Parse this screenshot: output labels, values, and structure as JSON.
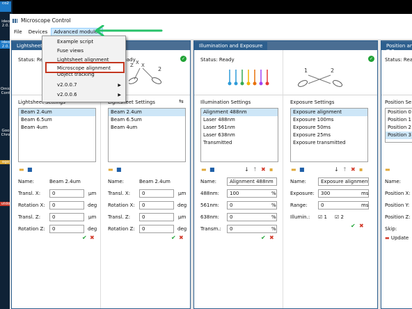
{
  "desktop": {
    "icons": [
      "co2",
      "ideo 2.0.",
      "ideo 2.0.",
      "Omic Cont",
      "Goo Chro",
      "ogo",
      "utdo"
    ]
  },
  "window": {
    "title": "Microscope Control"
  },
  "menubar": {
    "items": [
      "File",
      "Devices",
      "Advanced modules"
    ]
  },
  "dropdown": {
    "items": [
      {
        "label": "Example script"
      },
      {
        "label": "Fuse views"
      },
      {
        "label": "Lightsheet alignment"
      },
      {
        "label": "Microscope alignment",
        "highlighted": true
      },
      {
        "label": "Object tracking"
      },
      {
        "label": "v2.0.0.7",
        "submenu": true
      },
      {
        "label": "v2.0.0.6",
        "submenu": true
      }
    ]
  },
  "groups": {
    "lightsheet": {
      "tab": "Lightsheet 1",
      "status": "Status: Ready",
      "status_right": "Ready",
      "settings": [
        {
          "title": "Lightsheet Settings",
          "items": [
            "Beam 2.4um",
            "Beam 6.5um",
            "Beam 4um"
          ],
          "selected": 0,
          "fields": [
            {
              "label": "Name:",
              "value": "Beam 2.4um",
              "unit": ""
            },
            {
              "label": "Transl. X:",
              "value": "0",
              "unit": "μm"
            },
            {
              "label": "Rotation X:",
              "value": "0",
              "unit": "deg"
            },
            {
              "label": "Transl. Z:",
              "value": "0",
              "unit": "μm"
            },
            {
              "label": "Rotation Z:",
              "value": "0",
              "unit": "deg"
            }
          ]
        },
        {
          "title": "Lightsheet Settings",
          "items": [
            "Beam 2.4um",
            "Beam 6.5um",
            "Beam 4um"
          ],
          "selected": 0,
          "fields": [
            {
              "label": "Name:",
              "value": "Beam 2.4um",
              "unit": ""
            },
            {
              "label": "Transl. X:",
              "value": "0",
              "unit": "μm"
            },
            {
              "label": "Rotation X:",
              "value": "0",
              "unit": "deg"
            },
            {
              "label": "Transl. Z:",
              "value": "0",
              "unit": "μm"
            },
            {
              "label": "Rotation Z:",
              "value": "0",
              "unit": "deg"
            }
          ]
        }
      ]
    },
    "illumination": {
      "tab": "Illumination and Exposure",
      "status": "Status: Ready",
      "ill_title": "Illumination Settings",
      "ill_items": [
        "Alignment 488nm",
        "Laser 488nm",
        "Laser 561nm",
        "Laser 638nm",
        "Transmitted"
      ],
      "ill_fields": [
        {
          "label": "Name:",
          "value": "Alignment 488nm",
          "unit": ""
        },
        {
          "label": "488nm:",
          "value": "100",
          "unit": "%"
        },
        {
          "label": "561nm:",
          "value": "0",
          "unit": "%"
        },
        {
          "label": "638nm:",
          "value": "0",
          "unit": "%"
        },
        {
          "label": "Transm.:",
          "value": "0",
          "unit": "%"
        }
      ],
      "exp_title": "Exposure Settings",
      "exp_items": [
        "Exposure alignment",
        "Exposure 100ms",
        "Exposure 50ms",
        "Exposure 25ms",
        "Exposure transmitted"
      ],
      "exp_fields": [
        {
          "label": "Name:",
          "value": "Exposure alignment",
          "unit": ""
        },
        {
          "label": "Exposure:",
          "value": "300",
          "unit": "ms"
        },
        {
          "label": "Range:",
          "value": "0",
          "unit": "ms"
        }
      ],
      "illum_label": "Illumin.:",
      "check1": "1",
      "check2": "2",
      "laser_colors": [
        "#2e9bd8",
        "#2e9bd8",
        "#34a853",
        "#f4b400",
        "#e8710a",
        "#a142f4",
        "#e53935"
      ]
    },
    "position": {
      "tab": "Position and Z-S",
      "status": "Status: Ready",
      "title": "Position Se",
      "items": [
        "Position 0",
        "Position 1",
        "Position 2",
        "Position 3"
      ],
      "selected": 3,
      "fields": [
        {
          "label": "Name:",
          "value": "P"
        },
        {
          "label": "Position X:",
          "value": "-"
        },
        {
          "label": "Position Y:",
          "value": "-"
        },
        {
          "label": "Position Z:",
          "value": "-"
        }
      ],
      "skip_label": "Skip:",
      "update_label": "Update"
    }
  },
  "diagram": {
    "label_1": "1",
    "label_2": "2",
    "label_z": "Z",
    "label_x": "X"
  },
  "colors": {
    "accent": "#2d5f8e",
    "highlight_box": "#c3361f",
    "annotation_arrow": "#27c26a",
    "ok_green": "#21a336"
  }
}
